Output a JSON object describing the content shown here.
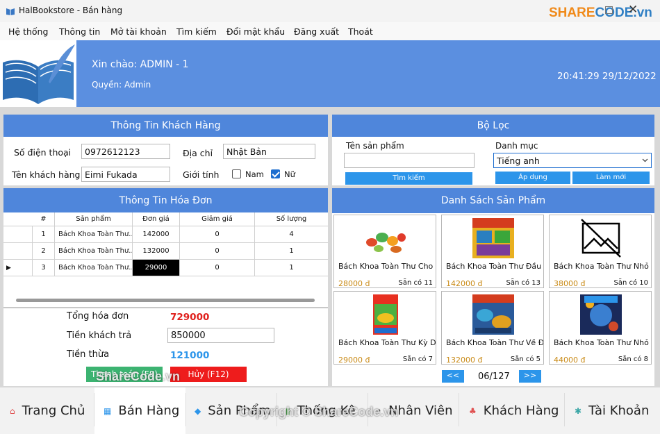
{
  "window": {
    "title": "HalBookstore - Bán hàng",
    "close_glyph": "✕",
    "watermark_brand_a": "SHARE",
    "watermark_brand_b": "CODE.vn"
  },
  "menu": [
    "Hệ thống",
    "Thông tin",
    "Mở tài khoản",
    "Tìm kiếm",
    "Đổi mật khẩu",
    "Đăng xuất",
    "Thoát"
  ],
  "header": {
    "greeting": "Xin chào: ADMIN - 1",
    "role": "Quyền: Admin",
    "datetime": "20:41:29 29/12/2022"
  },
  "customer": {
    "title": "Thông Tin Khách Hàng",
    "phone_label": "Số điện thoại",
    "phone": "0972612123",
    "address_label": "Địa chỉ",
    "address": "Nhật Bản",
    "name_label": "Tên khách hàng",
    "name": "Eimi Fukada",
    "gender_label": "Giới tính",
    "male": "Nam",
    "female": "Nữ",
    "male_checked": false,
    "female_checked": true
  },
  "filter": {
    "title": "Bộ Lọc",
    "product_label": "Tên sản phẩm",
    "product_value": "",
    "category_label": "Danh mục",
    "category_value": "Tiếng anh",
    "search_btn": "Tìm kiếm",
    "apply_btn": "Áp dụng",
    "reset_btn": "Làm mới"
  },
  "invoice": {
    "title": "Thông Tin Hóa Đơn",
    "columns": [
      "#",
      "Sản phẩm",
      "Đơn giá",
      "Giảm giá",
      "Số lượng"
    ],
    "rows": [
      [
        "1",
        "Bách Khoa Toàn Thư...",
        "142000",
        "0",
        "4"
      ],
      [
        "2",
        "Bách Khoa Toàn Thư...",
        "132000",
        "0",
        "1"
      ],
      [
        "3",
        "Bách Khoa Toàn Thư...",
        "29000",
        "0",
        "1"
      ]
    ],
    "row_marker": "▶",
    "total_label": "Tổng hóa đơn",
    "total": "729000",
    "paid_label": "Tiền khách trả",
    "paid": "850000",
    "change_label": "Tiền thừa",
    "change": "121000",
    "pay_btn": "Thanh toán (F8)",
    "cancel_btn": "Hủy (F12)"
  },
  "products": {
    "title": "Danh Sách Sản Phẩm",
    "items": [
      {
        "name": "Bách Khoa Toàn Thư Cho Bé",
        "price": "28000 đ",
        "stock": "Sẵn có 11"
      },
      {
        "name": "Bách Khoa Toàn Thư Đầu Tiên",
        "price": "142000 đ",
        "stock": "Sẵn có 13"
      },
      {
        "name": "Bách Khoa Toàn Thư Nhỏ -",
        "price": "38000 đ",
        "stock": "Sẵn có 10"
      },
      {
        "name": "Bách Khoa Toàn Thư Kỳ Diệu",
        "price": "29000 đ",
        "stock": "Sẵn có 7"
      },
      {
        "name": "Bách Khoa Toàn Thư Về Đời",
        "price": "132000 đ",
        "stock": "Sẵn có 5"
      },
      {
        "name": "Bách Khoa Toàn Thư Nhỏ -",
        "price": "44000 đ",
        "stock": "Sẵn có 8"
      }
    ],
    "prev": "<<",
    "next": ">>",
    "page": "06/127"
  },
  "nav": [
    "Trang Chủ",
    "Bán Hàng",
    "Sản Phẩm",
    "Thống Kê",
    "Nhân Viên",
    "Khách Hàng",
    "Tài Khoản"
  ],
  "watermarks": {
    "center": "ShareCode.vn",
    "bottom": "Copyright © ShareCode.vn"
  },
  "colors": {
    "accent": "#4f86db",
    "header": "#5b8fe0",
    "total": "#e0201c",
    "change": "#2c95ea",
    "pay": "#3cb371",
    "cancel": "#ee1c1c",
    "price": "#c98a16"
  }
}
